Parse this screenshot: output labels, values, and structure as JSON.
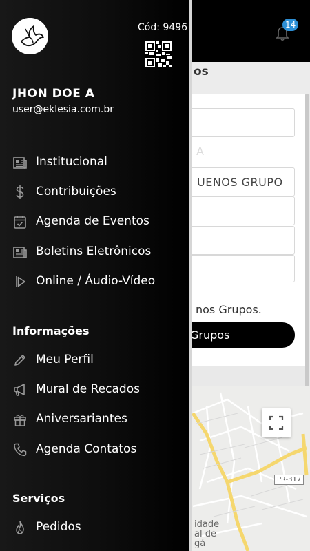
{
  "background_app": {
    "notification_count": "14",
    "page_title_fragment": "os",
    "field_placeholder_fragment": "A",
    "field_value_fragment": "UENOS GRUPO",
    "info_text_fragment": "nos Grupos.",
    "button_label_fragment": "Grupos",
    "map": {
      "road_label": "PR-317",
      "place_label_lines": [
        "idade",
        "al de",
        "gá"
      ]
    }
  },
  "drawer": {
    "code_label": "Cód: 9496",
    "user": {
      "name": "JHON DOE A",
      "email": "user@eklesia.com.br"
    },
    "main_items": [
      {
        "label": "Institucional",
        "icon": "newspaper-icon"
      },
      {
        "label": "Contribuições",
        "icon": "dollar-icon"
      },
      {
        "label": "Agenda de Eventos",
        "icon": "calendar-check-icon"
      },
      {
        "label": "Boletins Eletrônicos",
        "icon": "newspaper-icon"
      },
      {
        "label": "Online / Áudio-Vídeo",
        "icon": "play-icon"
      }
    ],
    "sections": [
      {
        "title": "Informações",
        "items": [
          {
            "label": "Meu Perfil",
            "icon": "pencil-icon"
          },
          {
            "label": "Mural de Recados",
            "icon": "megaphone-icon"
          },
          {
            "label": "Aniversariantes",
            "icon": "gift-icon"
          },
          {
            "label": "Agenda Contatos",
            "icon": "phone-icon"
          }
        ]
      },
      {
        "title": "Serviços",
        "items": [
          {
            "label": "Pedidos",
            "icon": "flame-icon"
          }
        ]
      }
    ]
  },
  "colors": {
    "badge": "#2d8fd5",
    "drawer_bg": "#0d0d0d",
    "map_road": "#f5d76e"
  }
}
